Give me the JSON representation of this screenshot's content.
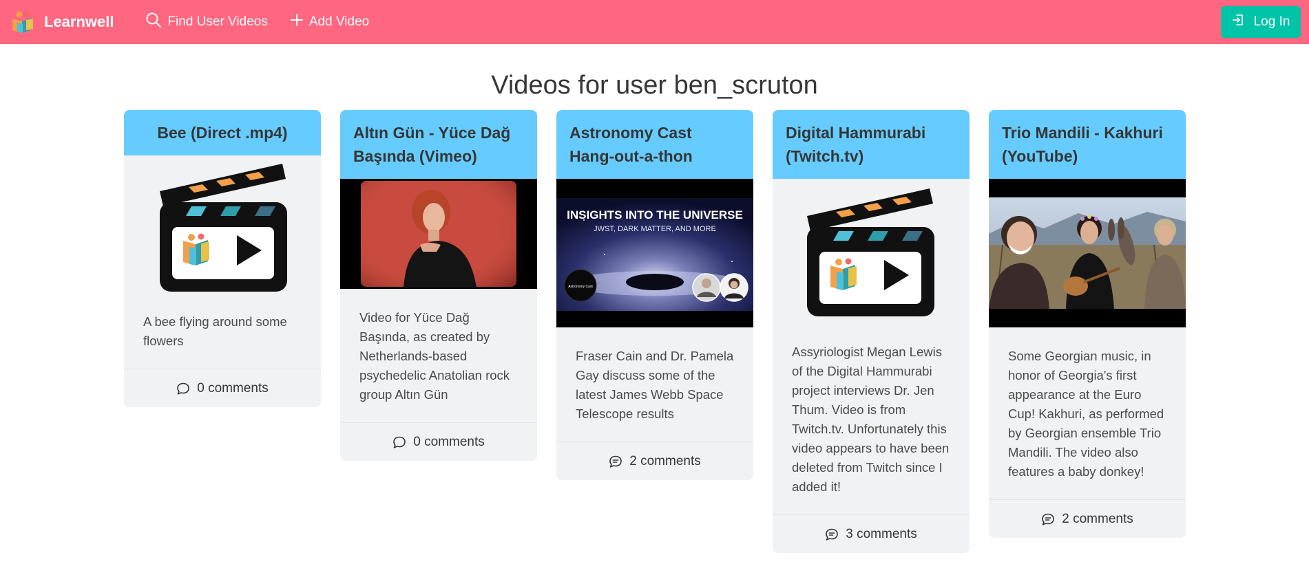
{
  "navbar": {
    "brand": "Learnwell",
    "find_videos": "Find User Videos",
    "add_video": "Add Video",
    "login": "Log In"
  },
  "page": {
    "title": "Videos for user ben_scruton"
  },
  "videos": [
    {
      "title": "Bee (Direct .mp4)",
      "thumbnail": "clapperboard-placeholder",
      "description": "A bee flying around some flowers",
      "comments": "0 comments"
    },
    {
      "title": "Altın Gün - Yüce Dağ Başında (Vimeo)",
      "thumbnail": "woman-in-black-dress-red-backdrop",
      "description": "Video for Yüce Dağ Başında, as created by Netherlands-based psychedelic Anatolian rock group Altın Gün",
      "comments": "0 comments"
    },
    {
      "title": "Astronomy Cast Hang-out-a-thon",
      "thumbnail": "black-hole-space-banner",
      "thumb_heading": "INSIGHTS INTO THE UNIVERSE",
      "thumb_subheading": "JWST, DARK MATTER, AND MORE",
      "thumb_logo": "Astronomy Cast",
      "description": "Fraser Cain and Dr. Pamela Gay discuss some of the latest James Webb Space Telescope results",
      "comments": "2 comments"
    },
    {
      "title": "Digital Hammurabi (Twitch.tv)",
      "thumbnail": "clapperboard-placeholder",
      "description": "Assyriologist Megan Lewis of the Digital Hammurabi project interviews Dr. Jen Thum. Video is from Twitch.tv. Unfortunately this video appears to have been deleted from Twitch since I added it!",
      "comments": "3 comments"
    },
    {
      "title": "Trio Mandili - Kakhuri (YouTube)",
      "thumbnail": "three-women-with-donkey-vineyard",
      "description": "Some Georgian music, in honor of Georgia's first appearance at the Euro Cup! Kakhuri, as performed by Georgian ensemble Trio Mandili. The video also features a baby donkey!",
      "comments": "2 comments"
    }
  ],
  "icons": {
    "brand": "learnwell-logo-icon",
    "search": "search-icon",
    "add": "plus-icon",
    "login": "login-icon",
    "comment_empty": "speech-bubble-icon",
    "comment_filled": "speech-bubble-lines-icon"
  },
  "colors": {
    "navbar": "#ff6680",
    "card_header": "#66ccff",
    "card_body": "#f1f2f4",
    "login_button": "#00c4a7"
  }
}
